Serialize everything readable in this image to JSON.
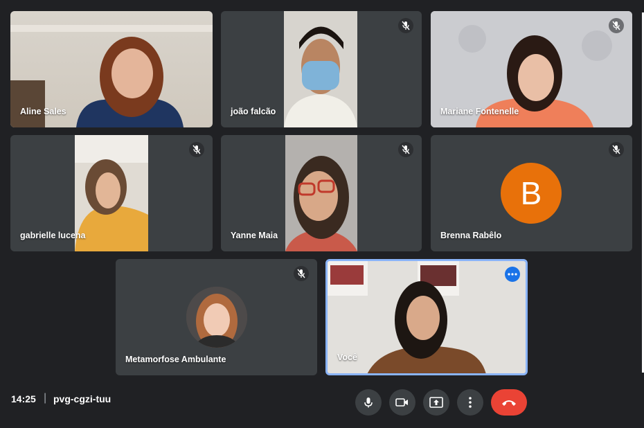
{
  "participants": [
    {
      "name": "Aline Sales",
      "muted": false
    },
    {
      "name": "joão falcão",
      "muted": true
    },
    {
      "name": "Mariane Fontenelle",
      "muted": true
    },
    {
      "name": "gabrielle lucena",
      "muted": true
    },
    {
      "name": "Yanne Maia",
      "muted": true
    },
    {
      "name": "Brenna Rabêlo",
      "muted": true,
      "avatar_letter": "B"
    },
    {
      "name": "Metamorfose Ambulante",
      "muted": true
    },
    {
      "name": "Você",
      "muted": false,
      "self": true
    }
  ],
  "meeting": {
    "time": "14:25",
    "separator": "|",
    "code": "pvg-cgzi-tuu"
  },
  "icons": {
    "mic": "microphone-icon",
    "camera": "video-camera-icon",
    "present": "present-screen-icon",
    "more": "more-options-icon",
    "hangup": "hang-up-icon",
    "muted": "mic-off-icon"
  },
  "colors": {
    "background": "#202124",
    "tile": "#3c4043",
    "accent": "#8ab4f8",
    "hangup": "#ea4335",
    "avatar": "#e8710a"
  }
}
